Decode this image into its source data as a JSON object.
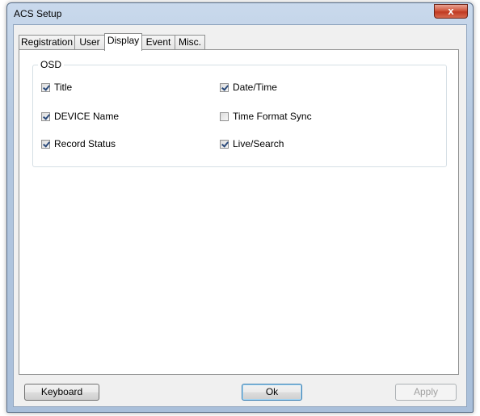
{
  "window": {
    "title": "ACS Setup",
    "close_glyph": "x"
  },
  "tabs": [
    {
      "label": "Registration",
      "active": false
    },
    {
      "label": "User",
      "active": false
    },
    {
      "label": "Display",
      "active": true
    },
    {
      "label": "Event",
      "active": false
    },
    {
      "label": "Misc.",
      "active": false
    }
  ],
  "osd": {
    "group_label": "OSD",
    "options": [
      {
        "label": "Title",
        "checked": true
      },
      {
        "label": "Date/Time",
        "checked": true
      },
      {
        "label": "DEVICE Name",
        "checked": true
      },
      {
        "label": "Time Format Sync",
        "checked": false
      },
      {
        "label": "Record Status",
        "checked": true
      },
      {
        "label": "Live/Search",
        "checked": true
      }
    ]
  },
  "buttons": {
    "keyboard": "Keyboard",
    "ok": "Ok",
    "apply": "Apply"
  },
  "colors": {
    "accent": "#3c7fb1",
    "close": "#c03a22"
  }
}
